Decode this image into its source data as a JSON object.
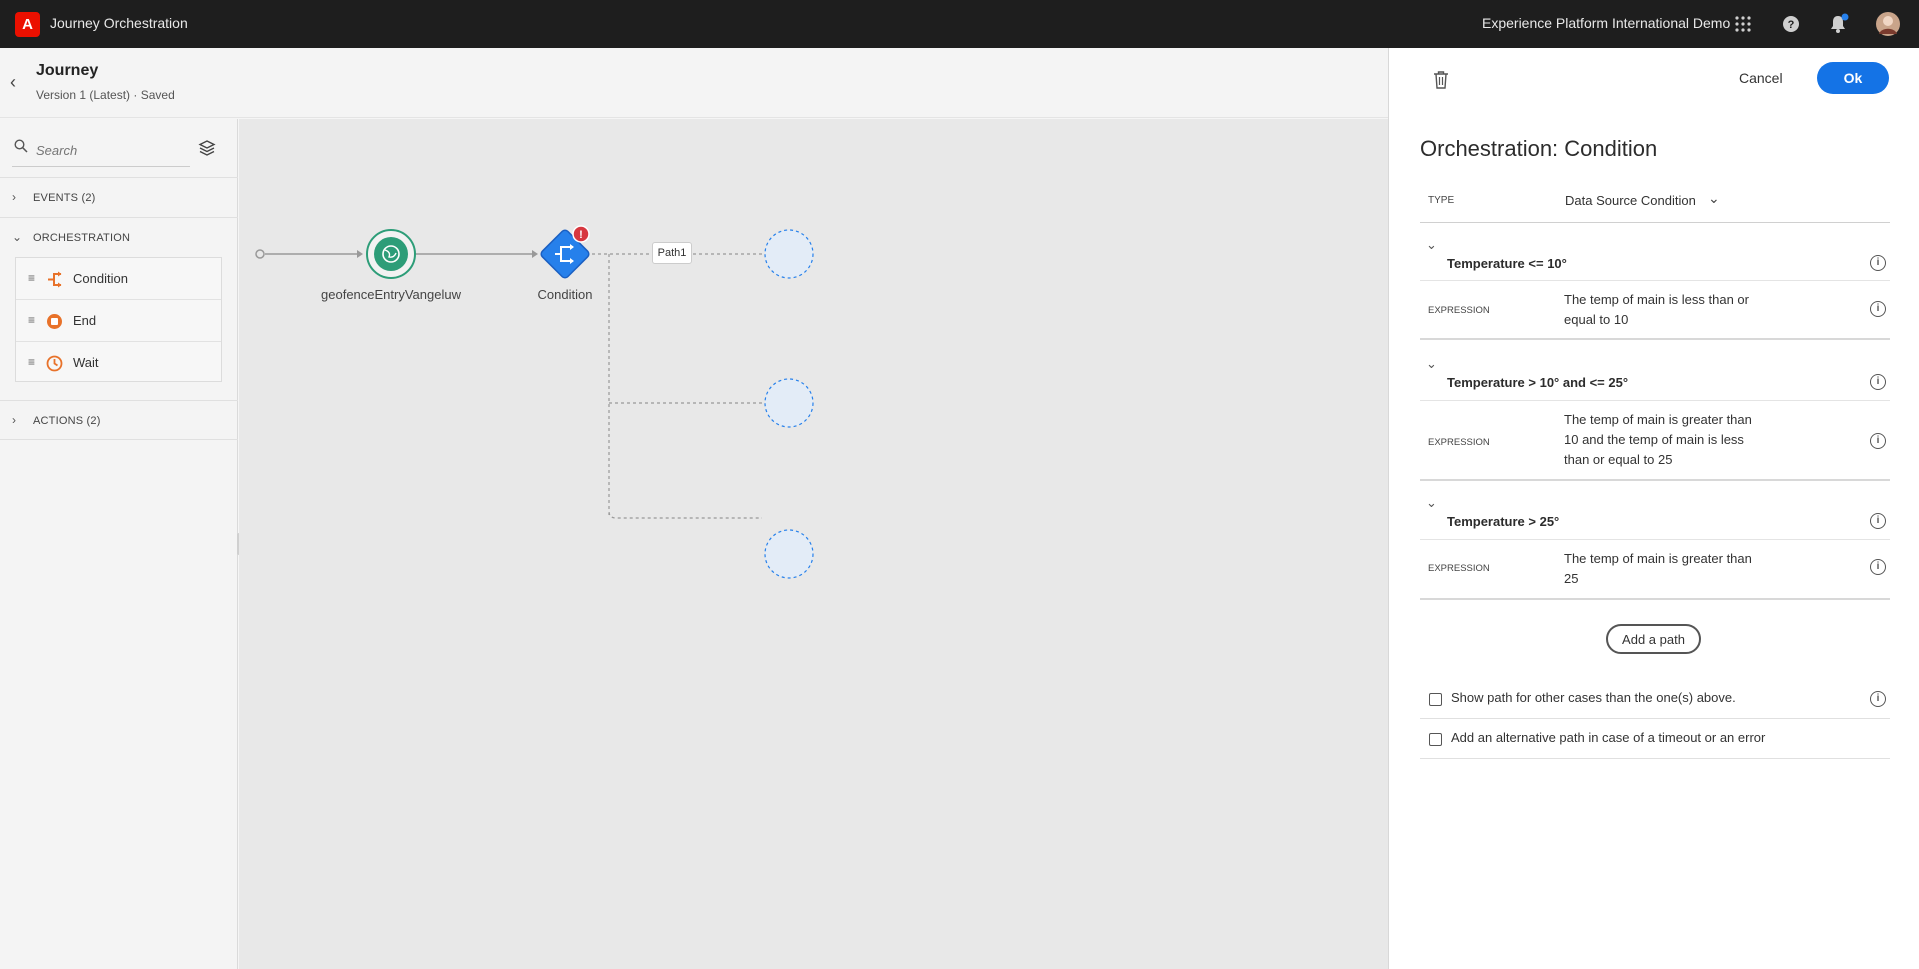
{
  "topbar": {
    "logo_letter": "A",
    "app_title": "Journey Orchestration",
    "org_name": "Experience Platform International Demo",
    "icons": [
      "apps-grid-icon",
      "help-icon",
      "notifications-bell-icon",
      "user-avatar"
    ]
  },
  "header": {
    "title": "Journey",
    "subtitle": "Version 1 (Latest) · Saved"
  },
  "palette": {
    "search_placeholder": "Search",
    "sections": {
      "events": "EVENTS (2)",
      "orchestration": "ORCHESTRATION",
      "actions": "ACTIONS (2)"
    },
    "orchestration_items": [
      {
        "label": "Condition",
        "icon": "condition-icon"
      },
      {
        "label": "End",
        "icon": "end-icon"
      },
      {
        "label": "Wait",
        "icon": "wait-clock-icon"
      }
    ]
  },
  "canvas": {
    "nodes": [
      {
        "label": "geofenceEntryVangeluw",
        "icon": "globe-icon"
      },
      {
        "label": "Condition",
        "icon": "condition-icon",
        "error": "!"
      }
    ],
    "path_tag": "Path1"
  },
  "panel": {
    "cancel_label": "Cancel",
    "ok_label": "Ok",
    "title": "Orchestration: Condition",
    "type_label": "TYPE",
    "type_value": "Data Source Condition",
    "conditions": [
      {
        "name": "Temperature <= 10°",
        "expression_label": "EXPRESSION",
        "expression": "The temp of main is less than or equal to 10"
      },
      {
        "name": "Temperature > 10° and <= 25°",
        "expression_label": "EXPRESSION",
        "expression": "The temp of main is greater than 10 and the temp of main is less than or equal to 25"
      },
      {
        "name": "Temperature > 25°",
        "expression_label": "EXPRESSION",
        "expression": "The temp of main is greater than 25"
      }
    ],
    "add_path_label": "Add a path",
    "checkboxes": [
      {
        "label": "Show path for other cases than the one(s) above."
      },
      {
        "label": "Add an alternative path in case of a timeout or an error"
      }
    ]
  },
  "colors": {
    "accent": "#1473e6",
    "topbar_bg": "#1e1e1e",
    "orchestration_orange": "#e8722a",
    "event_green": "#2d9d78",
    "error_red": "#d7373f"
  }
}
